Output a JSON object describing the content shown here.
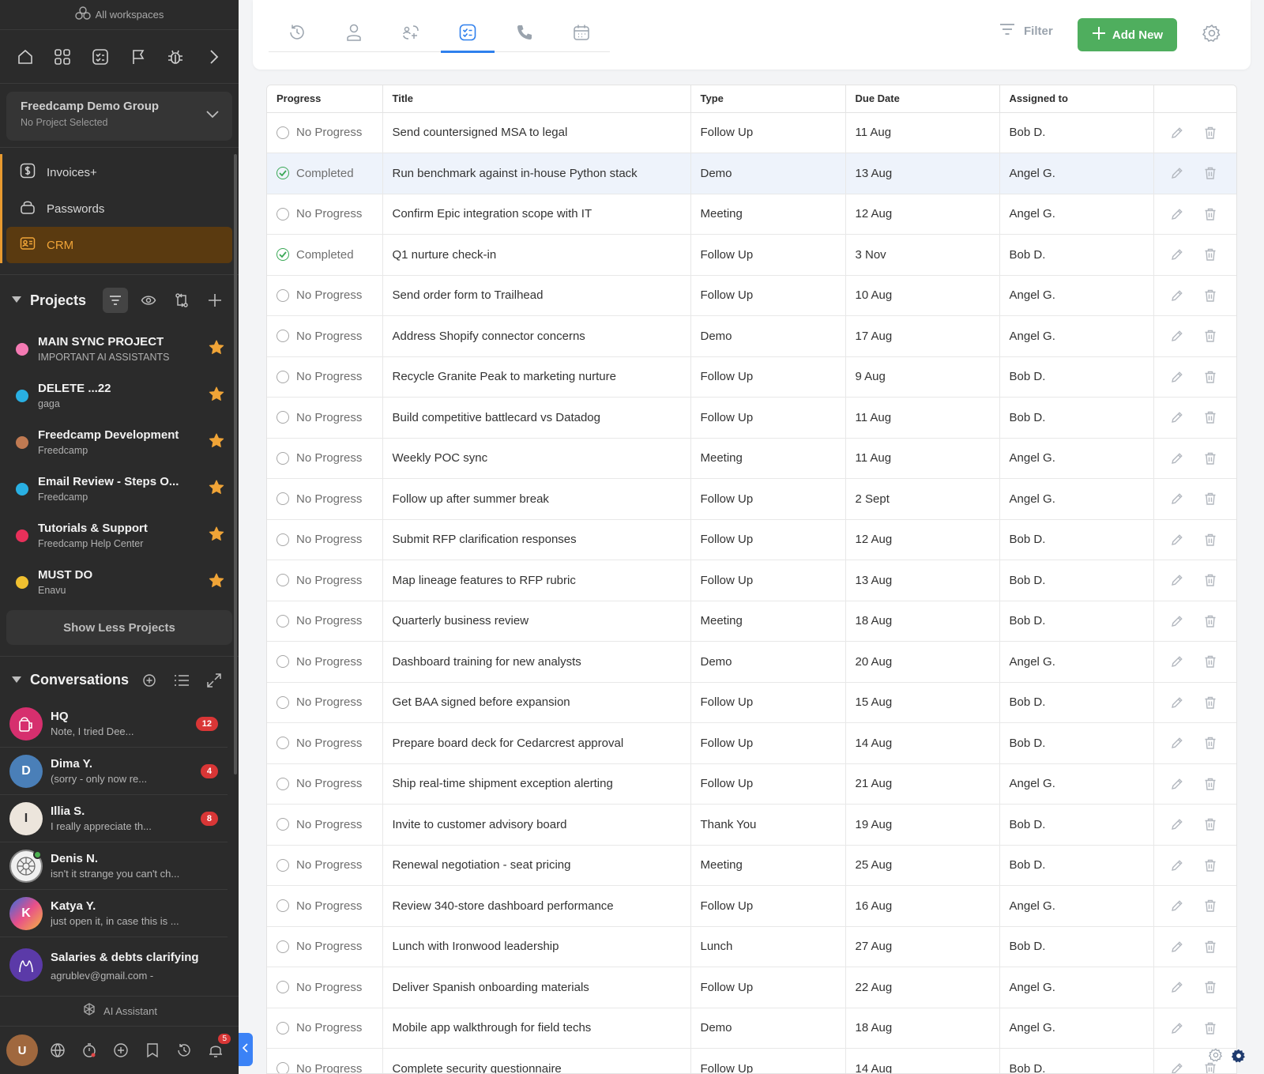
{
  "sidebar": {
    "workspaces_label": "All workspaces",
    "group": {
      "name": "Freedcamp Demo Group",
      "sub": "No Project Selected"
    },
    "apps": [
      {
        "label": "Invoices+",
        "icon": "dollar-icon"
      },
      {
        "label": "Passwords",
        "icon": "lock-icon"
      },
      {
        "label": "CRM",
        "icon": "contact-card-icon",
        "active": true
      }
    ],
    "projects_title": "Projects",
    "projects": [
      {
        "name": "MAIN SYNC PROJECT",
        "sub": "IMPORTANT AI ASSISTANTS",
        "color": "#f47ab3"
      },
      {
        "name": "DELETE ...22",
        "sub": "gaga",
        "color": "#29b0e3"
      },
      {
        "name": "Freedcamp Development",
        "sub": "Freedcamp",
        "color": "#c07a52"
      },
      {
        "name": "Email Review - Steps O...",
        "sub": "Freedcamp",
        "color": "#29b0e3"
      },
      {
        "name": "Tutorials & Support",
        "sub": "Freedcamp Help Center",
        "color": "#e8305a"
      },
      {
        "name": "MUST DO",
        "sub": "Enavu",
        "color": "#f0c030"
      }
    ],
    "show_less_label": "Show Less Projects",
    "conversations_title": "Conversations",
    "conversations": [
      {
        "name": "HQ",
        "msg": "Note, I tried Dee...",
        "badge": "12",
        "avatar_color": "#d62f6e"
      },
      {
        "name": "Dima Y.",
        "msg": "(sorry - only now re...",
        "badge": "4",
        "avatar_color": "#4a7fb8"
      },
      {
        "name": "Illia S.",
        "msg": "I really appreciate th...",
        "badge": "8",
        "avatar_color": "#ece5dc"
      },
      {
        "name": "Denis N.",
        "msg": "isn't it strange you can't ch...",
        "badge": "",
        "avatar_color": "#f0f0f0"
      },
      {
        "name": "Katya Y.",
        "msg": "just open it, in case this is ...",
        "badge": "",
        "avatar_color": "#7b5cd6"
      },
      {
        "name": "Salaries & debts clarifying",
        "msg": "agrublev@gmail.com -",
        "badge": "",
        "avatar_color": "#5b3aa8"
      }
    ],
    "ai_assistant_label": "AI Assistant",
    "notifications_count": "5"
  },
  "toolbar": {
    "tabs": [
      "history-icon",
      "person-icon",
      "link-icon",
      "tasks-icon",
      "phone-icon",
      "calendar-icon"
    ],
    "active_tab": 3,
    "filter_label": "Filter",
    "add_label": "Add New"
  },
  "table": {
    "columns": [
      "Progress",
      "Title",
      "Type",
      "Due Date",
      "Assigned to"
    ],
    "rows": [
      {
        "progress": "No Progress",
        "title": "Send countersigned MSA to legal",
        "type": "Follow Up",
        "due": "11 Aug",
        "assigned": "Bob D."
      },
      {
        "progress": "Completed",
        "title": "Run benchmark against in-house Python stack",
        "type": "Demo",
        "due": "13 Aug",
        "assigned": "Angel G.",
        "highlight": true
      },
      {
        "progress": "No Progress",
        "title": "Confirm Epic integration scope with IT",
        "type": "Meeting",
        "due": "12 Aug",
        "assigned": "Angel G."
      },
      {
        "progress": "Completed",
        "title": "Q1 nurture check-in",
        "type": "Follow Up",
        "due": "3 Nov",
        "assigned": "Bob D."
      },
      {
        "progress": "No Progress",
        "title": "Send order form to Trailhead",
        "type": "Follow Up",
        "due": "10 Aug",
        "assigned": "Angel G."
      },
      {
        "progress": "No Progress",
        "title": "Address Shopify connector concerns",
        "type": "Demo",
        "due": "17 Aug",
        "assigned": "Angel G."
      },
      {
        "progress": "No Progress",
        "title": "Recycle Granite Peak to marketing nurture",
        "type": "Follow Up",
        "due": "9 Aug",
        "assigned": "Bob D."
      },
      {
        "progress": "No Progress",
        "title": "Build competitive battlecard vs Datadog",
        "type": "Follow Up",
        "due": "11 Aug",
        "assigned": "Bob D."
      },
      {
        "progress": "No Progress",
        "title": "Weekly POC sync",
        "type": "Meeting",
        "due": "11 Aug",
        "assigned": "Angel G."
      },
      {
        "progress": "No Progress",
        "title": "Follow up after summer break",
        "type": "Follow Up",
        "due": "2 Sept",
        "assigned": "Angel G."
      },
      {
        "progress": "No Progress",
        "title": "Submit RFP clarification responses",
        "type": "Follow Up",
        "due": "12 Aug",
        "assigned": "Bob D."
      },
      {
        "progress": "No Progress",
        "title": "Map lineage features to RFP rubric",
        "type": "Follow Up",
        "due": "13 Aug",
        "assigned": "Bob D."
      },
      {
        "progress": "No Progress",
        "title": "Quarterly business review",
        "type": "Meeting",
        "due": "18 Aug",
        "assigned": "Bob D."
      },
      {
        "progress": "No Progress",
        "title": "Dashboard training for new analysts",
        "type": "Demo",
        "due": "20 Aug",
        "assigned": "Angel G."
      },
      {
        "progress": "No Progress",
        "title": "Get BAA signed before expansion",
        "type": "Follow Up",
        "due": "15 Aug",
        "assigned": "Bob D."
      },
      {
        "progress": "No Progress",
        "title": "Prepare board deck for Cedarcrest approval",
        "type": "Follow Up",
        "due": "14 Aug",
        "assigned": "Bob D."
      },
      {
        "progress": "No Progress",
        "title": "Ship real-time shipment exception alerting",
        "type": "Follow Up",
        "due": "21 Aug",
        "assigned": "Angel G."
      },
      {
        "progress": "No Progress",
        "title": "Invite to customer advisory board",
        "type": "Thank You",
        "due": "19 Aug",
        "assigned": "Bob D."
      },
      {
        "progress": "No Progress",
        "title": "Renewal negotiation - seat pricing",
        "type": "Meeting",
        "due": "25 Aug",
        "assigned": "Bob D."
      },
      {
        "progress": "No Progress",
        "title": "Review 340-store dashboard performance",
        "type": "Follow Up",
        "due": "16 Aug",
        "assigned": "Angel G."
      },
      {
        "progress": "No Progress",
        "title": "Lunch with Ironwood leadership",
        "type": "Lunch",
        "due": "27 Aug",
        "assigned": "Bob D."
      },
      {
        "progress": "No Progress",
        "title": "Deliver Spanish onboarding materials",
        "type": "Follow Up",
        "due": "22 Aug",
        "assigned": "Angel G."
      },
      {
        "progress": "No Progress",
        "title": "Mobile app walkthrough for field techs",
        "type": "Demo",
        "due": "18 Aug",
        "assigned": "Angel G."
      },
      {
        "progress": "No Progress",
        "title": "Complete security questionnaire",
        "type": "Follow Up",
        "due": "14 Aug",
        "assigned": "Bob D."
      }
    ]
  },
  "colors": {
    "accent": "#f0a437",
    "add_button": "#4fae5e",
    "active_tab": "#2f80ed",
    "completed": "#3aa856"
  }
}
